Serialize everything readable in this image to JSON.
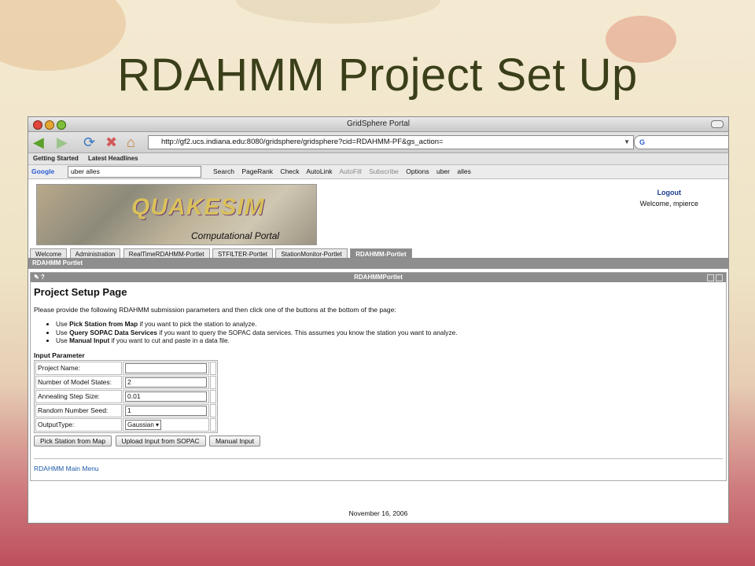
{
  "slide": {
    "title": "RDAHMM Project Set Up"
  },
  "window": {
    "title": "GridSphere Portal"
  },
  "navigation": {
    "url": "http://gf2.ucs.indiana.edu:8080/gridsphere/gridsphere?cid=RDAHMM-PF&gs_action="
  },
  "bookmarks": [
    "Getting Started",
    "Latest Headlines"
  ],
  "google_toolbar": {
    "brand": "Google",
    "query": "uber alles",
    "tools": [
      "Search",
      "PageRank",
      "Check",
      "AutoLink",
      "AutoFill",
      "Subscribe",
      "Options",
      "uber",
      "alles"
    ]
  },
  "portal": {
    "banner_title": "QUAKESIM",
    "banner_subtitle": "Computational Portal",
    "logout_label": "Logout",
    "welcome_text": "Welcome, mpierce",
    "tabs": [
      "Welcome",
      "Administration",
      "RealTimeRDAHMM-Portlet",
      "STFILTER-Portlet",
      "StationMonitor-Portlet",
      "RDAHMM-Portlet"
    ],
    "active_tab_index": 5,
    "subnav_label": "RDAHMM Portlet"
  },
  "portlet": {
    "header_title": "RDAHMMPortlet",
    "page_title": "Project Setup Page",
    "intro": "Please provide the following RDAHMM submission parameters and then click one of the buttons at the bottom of the page:",
    "instructions": [
      {
        "prefix": "Use ",
        "bold": "Pick Station from Map",
        "suffix": " if you want to pick the station to analyze."
      },
      {
        "prefix": "Use ",
        "bold": "Query SOPAC Data Services",
        "suffix": " if you want to query the SOPAC data services. This assumes you know the station you want to analyze."
      },
      {
        "prefix": "Use ",
        "bold": "Manual Input",
        "suffix": " if you want to cut and paste in a data file."
      }
    ],
    "input_section_title": "Input Parameter",
    "params": [
      {
        "label": "Project Name:",
        "value": ""
      },
      {
        "label": "Number of Model States:",
        "value": "2"
      },
      {
        "label": "Annealing Step Size:",
        "value": "0.01"
      },
      {
        "label": "Random Number Seed:",
        "value": "1"
      },
      {
        "label": "OutputType:",
        "value": "Gaussian"
      }
    ],
    "buttons": [
      "Pick Station from Map",
      "Upload Input from SOPAC",
      "Manual Input"
    ],
    "main_menu_link": "RDAHMM Main Menu"
  },
  "footer": {
    "date": "November 16, 2006"
  },
  "colors": {
    "title": "#3a3f19",
    "link": "#1e5aa8",
    "tab_active": "#8b8b8b"
  }
}
